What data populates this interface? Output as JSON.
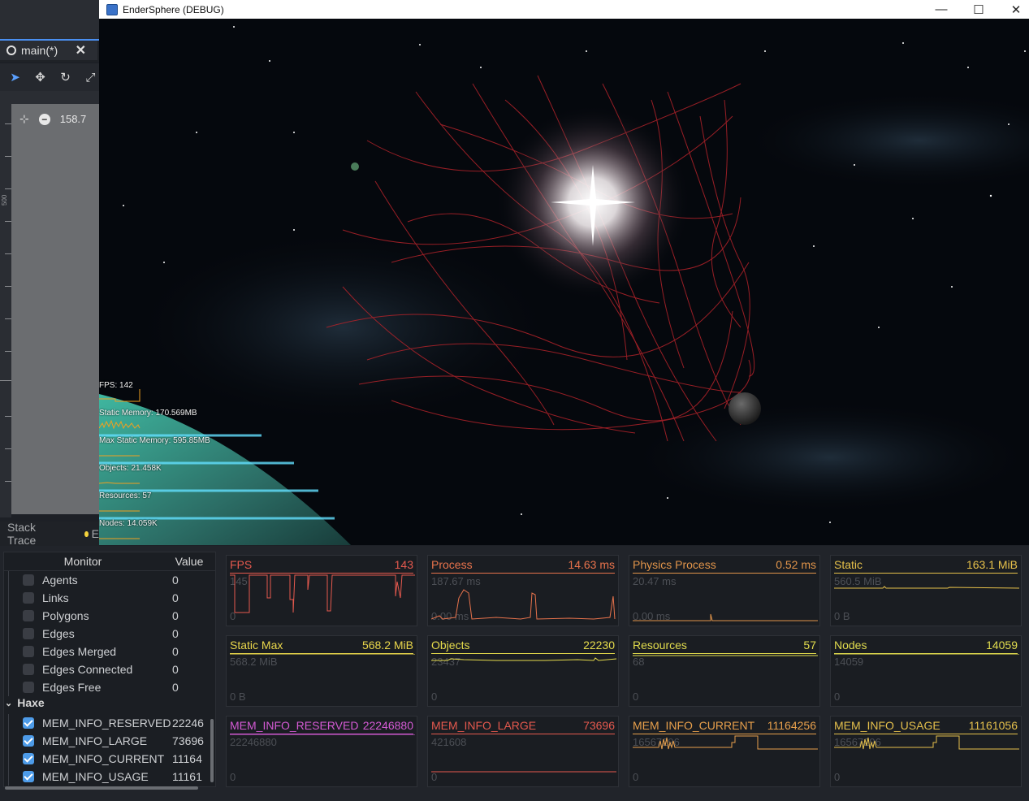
{
  "editor": {
    "tab_label": "main(*)",
    "zoom_value": "158.7",
    "ruler_label": "500",
    "stack_trace_label": "Stack Trace",
    "errors_initial": "E"
  },
  "game_window": {
    "title": "EnderSphere (DEBUG)",
    "minimize_glyph": "—",
    "maximize_glyph": "☐",
    "close_glyph": "✕"
  },
  "overlay": {
    "fps": "FPS: 142",
    "static_memory": "Static Memory: 170.569MB",
    "max_static_memory": "Max Static Memory: 595.85MB",
    "objects": "Objects: 21.458K",
    "resources": "Resources: 57",
    "nodes": "Nodes: 14.059K"
  },
  "monitor_tree": {
    "col_monitor": "Monitor",
    "col_value": "Value",
    "rows": [
      {
        "label": "Agents",
        "value": "0",
        "checked": false
      },
      {
        "label": "Links",
        "value": "0",
        "checked": false
      },
      {
        "label": "Polygons",
        "value": "0",
        "checked": false
      },
      {
        "label": "Edges",
        "value": "0",
        "checked": false
      },
      {
        "label": "Edges Merged",
        "value": "0",
        "checked": false
      },
      {
        "label": "Edges Connected",
        "value": "0",
        "checked": false
      },
      {
        "label": "Edges Free",
        "value": "0",
        "checked": false
      }
    ],
    "haxe_category": "Haxe",
    "haxe_rows": [
      {
        "label": "MEM_INFO_RESERVED",
        "value": "22246",
        "checked": true
      },
      {
        "label": "MEM_INFO_LARGE",
        "value": "73696",
        "checked": true
      },
      {
        "label": "MEM_INFO_CURRENT",
        "value": "11164",
        "checked": true
      },
      {
        "label": "MEM_INFO_USAGE",
        "value": "11161",
        "checked": true
      }
    ]
  },
  "graphs": [
    {
      "name": "FPS",
      "value": "143",
      "max": "145",
      "min": "0",
      "color": "#e5594e"
    },
    {
      "name": "Process",
      "value": "14.63 ms",
      "max": "187.67 ms",
      "min": "0.00 ms",
      "color": "#e8734c"
    },
    {
      "name": "Physics Process",
      "value": "0.52 ms",
      "max": "20.47 ms",
      "min": "0.00 ms",
      "color": "#e0944a"
    },
    {
      "name": "Static",
      "value": "163.1 MiB",
      "max": "560.5 MiB",
      "min": "0 B",
      "color": "#e7c14a"
    },
    {
      "name": "Static Max",
      "value": "568.2 MiB",
      "max": "568.2 MiB",
      "min": "0 B",
      "color": "#e9d64b"
    },
    {
      "name": "Objects",
      "value": "22230",
      "max": "23437",
      "min": "0",
      "color": "#e6dc4c"
    },
    {
      "name": "Resources",
      "value": "57",
      "max": "68",
      "min": "0",
      "color": "#e3dd4d"
    },
    {
      "name": "Nodes",
      "value": "14059",
      "max": "14059",
      "min": "0",
      "color": "#e1dc4e"
    },
    {
      "name": "MEM_INFO_RESERVED",
      "value": "22246880",
      "max": "22246880",
      "min": "0",
      "color": "#d45ad4"
    },
    {
      "name": "MEM_INFO_LARGE",
      "value": "73696",
      "max": "421608",
      "min": "0",
      "color": "#e5594e"
    },
    {
      "name": "MEM_INFO_CURRENT",
      "value": "11164256",
      "max": "16567296",
      "min": "0",
      "color": "#e8a04c"
    },
    {
      "name": "MEM_INFO_USAGE",
      "value": "11161056",
      "max": "16567296",
      "min": "0",
      "color": "#e5c04c"
    }
  ]
}
